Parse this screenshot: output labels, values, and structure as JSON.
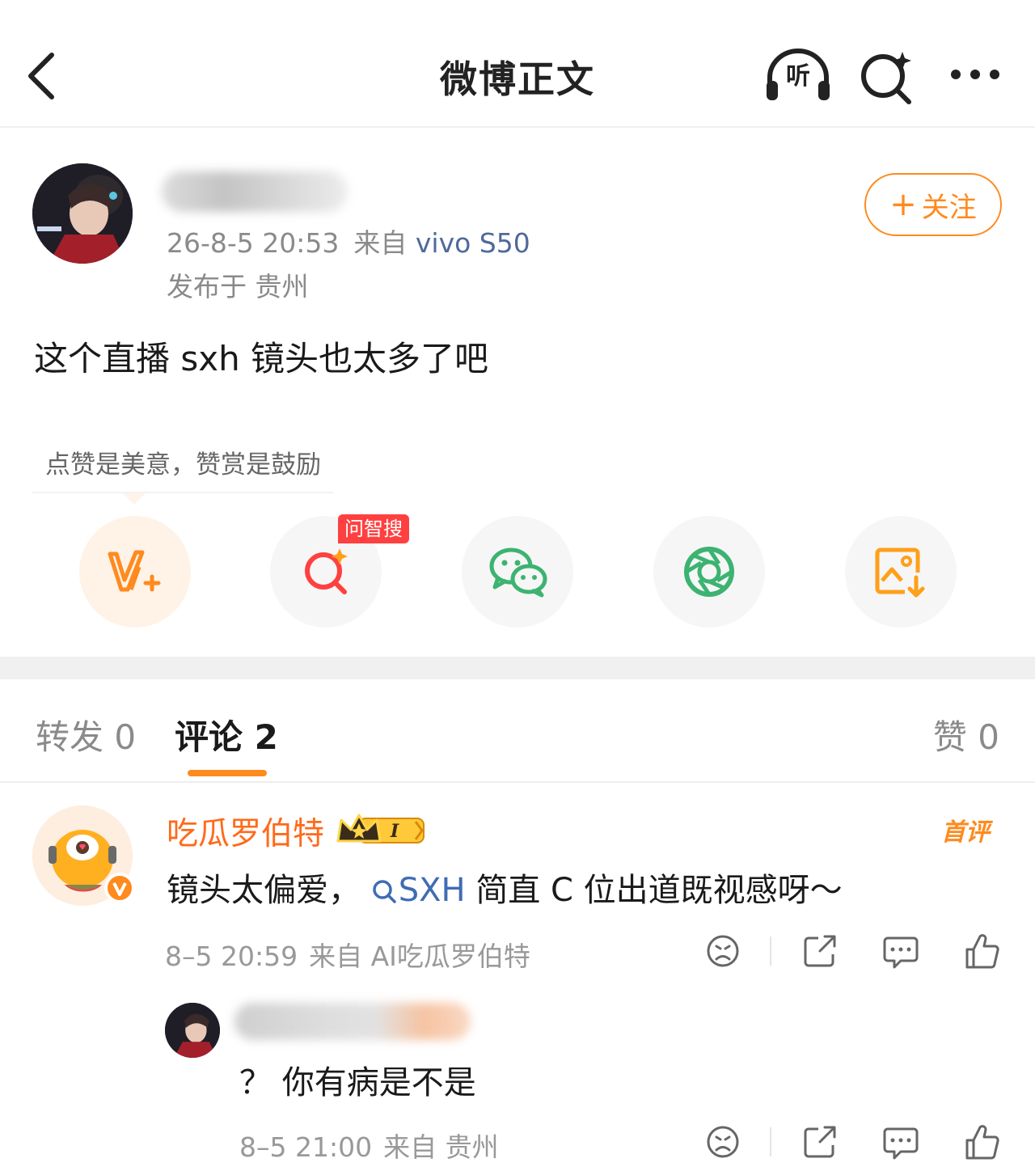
{
  "header": {
    "title": "微博正文",
    "listen_label": "听"
  },
  "post": {
    "author_name": "",
    "time": "26-8-5 20:53",
    "source_prefix": "来自",
    "device": "vivo S50",
    "location": "发布于 贵州",
    "follow_label": "关注",
    "text": "这个直播 sxh 镜头也太多了吧"
  },
  "reward_tip": "点赞是美意，赞赏是鼓励",
  "actions": {
    "ai_badge": "问智搜",
    "items": [
      {
        "name": "reward",
        "icon": "reward-v-icon",
        "color": "#ff8a1e"
      },
      {
        "name": "ai-search",
        "icon": "ai-search-icon",
        "color": "#ff4040"
      },
      {
        "name": "wechat",
        "icon": "wechat-icon",
        "color": "#3cb371"
      },
      {
        "name": "moments",
        "icon": "moments-icon",
        "color": "#3cb371"
      },
      {
        "name": "save-image",
        "icon": "save-image-icon",
        "color": "#ff9f1a"
      }
    ]
  },
  "tabs": {
    "repost": "转发 0",
    "comment": "评论 2",
    "like": "赞 0"
  },
  "comments": [
    {
      "name": "吃瓜罗伯特",
      "level_badge": "I",
      "tag": "首评",
      "text_before": "镜头太偏爱，",
      "link_text": "SXH",
      "text_after": " 简直 C 位出道既视感呀～",
      "time": "8–5 20:59",
      "source": "来自 AI吃瓜罗伯特"
    }
  ],
  "reply": {
    "name": "",
    "text": "？ 你有病是不是",
    "time": "8–5 21:00",
    "source": "来自 贵州"
  },
  "colors": {
    "accent": "#ff8a1e",
    "link": "#3f6cb4",
    "meta": "#8a8a8a"
  }
}
